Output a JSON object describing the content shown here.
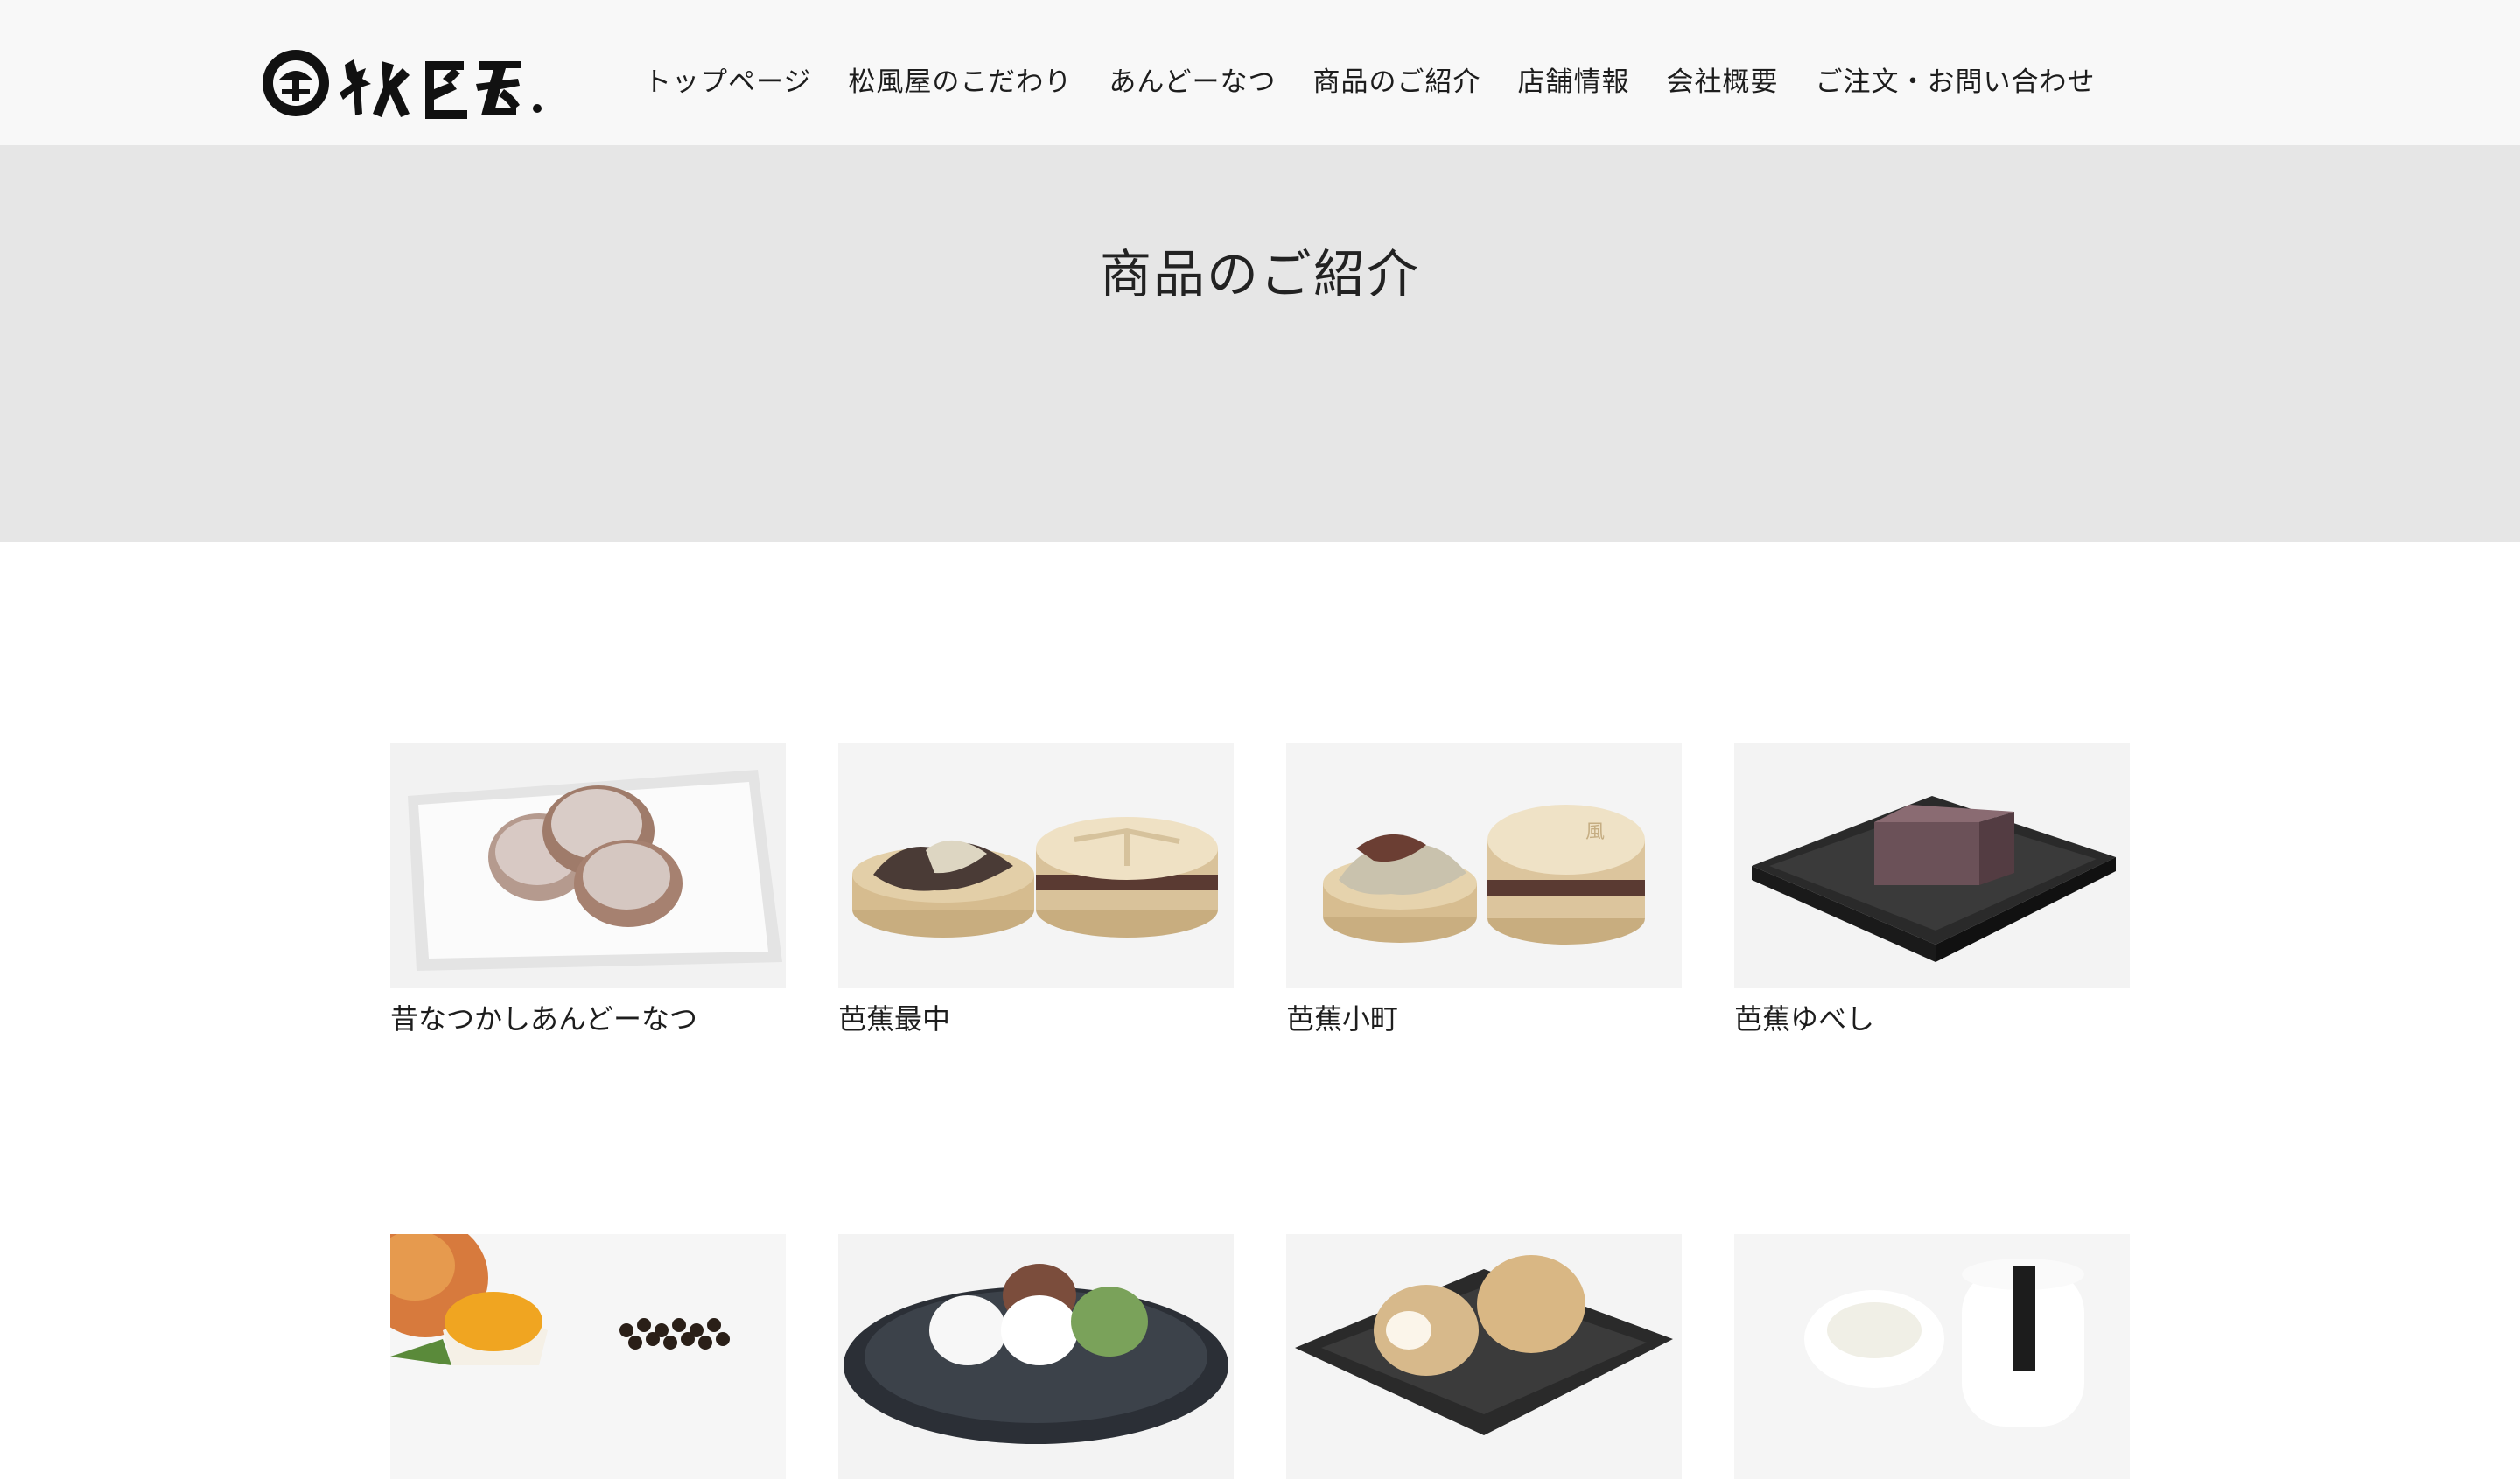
{
  "site": {
    "logo_text": "松風屋.",
    "nav": [
      {
        "label": "トップページ"
      },
      {
        "label": "松風屋のこだわり"
      },
      {
        "label": "あんどーなつ"
      },
      {
        "label": "商品のご紹介"
      },
      {
        "label": "店舗情報"
      },
      {
        "label": "会社概要"
      },
      {
        "label": "ご注文・お問い合わせ"
      }
    ]
  },
  "hero": {
    "title": "商品のご紹介"
  },
  "products": [
    {
      "name": "昔なつかしあんどーなつ"
    },
    {
      "name": "芭蕉最中"
    },
    {
      "name": "芭蕉小町"
    },
    {
      "name": "芭蕉ゆべし"
    },
    {
      "name": ""
    },
    {
      "name": ""
    },
    {
      "name": ""
    },
    {
      "name": ""
    }
  ],
  "colors": {
    "header_bg": "#f8f8f8",
    "hero_bg": "#e6e6e6",
    "text": "#1d1d1d"
  }
}
